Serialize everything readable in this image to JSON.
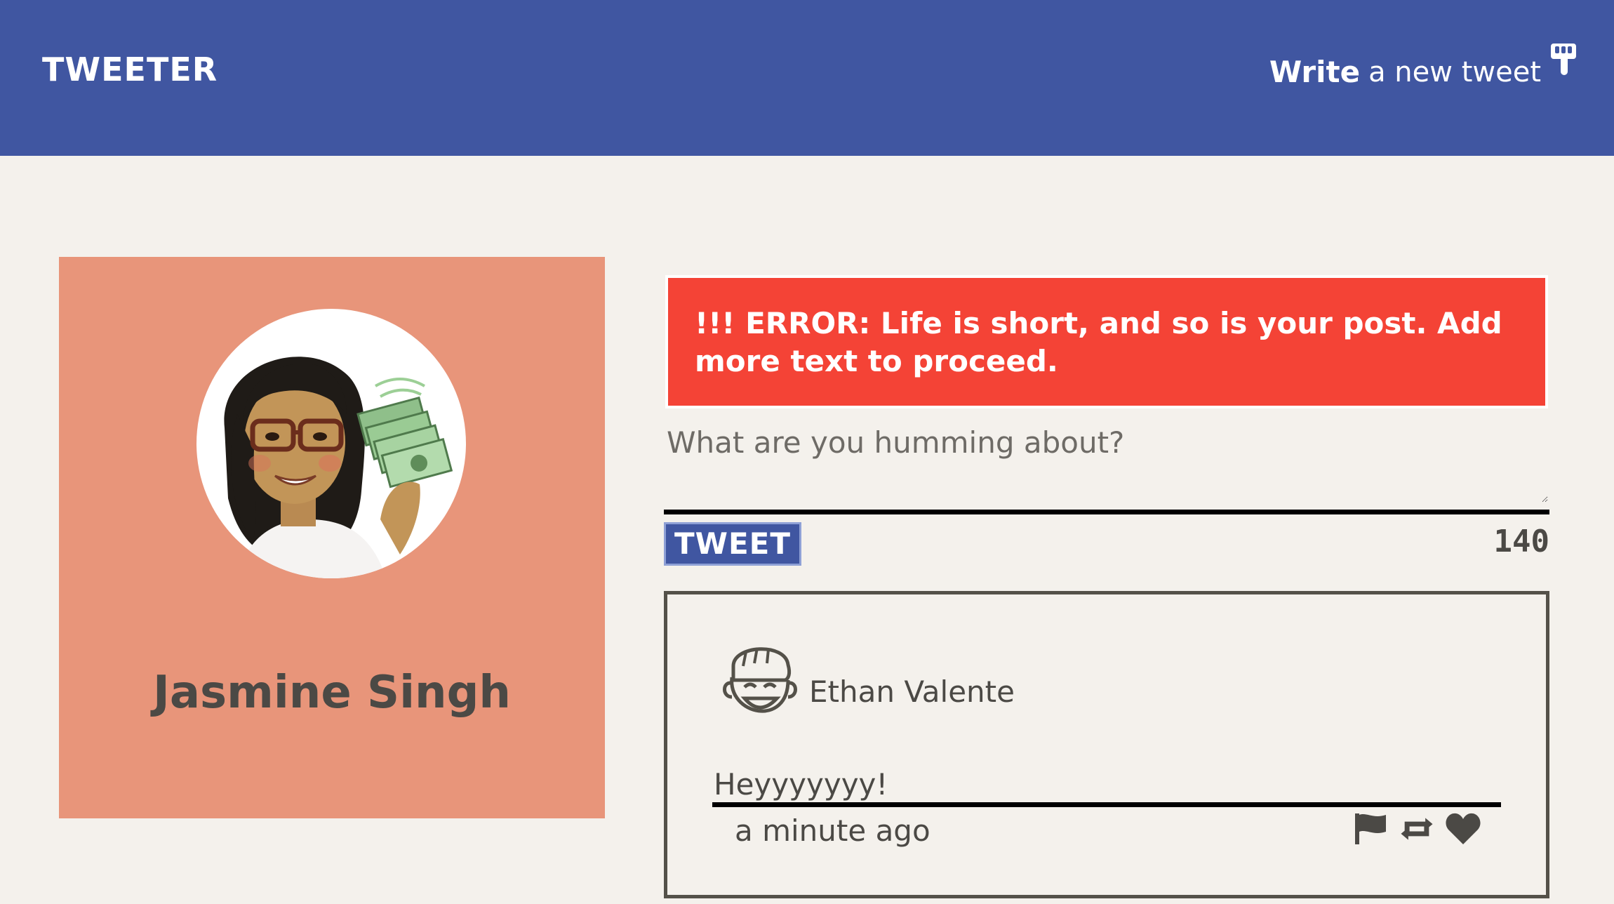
{
  "header": {
    "brand": "TWEETER",
    "compose_write": "Write",
    "compose_rest": "a new tweet",
    "compose_icon": "pointing-hand-down-icon"
  },
  "profile": {
    "name": "Jasmine Singh",
    "avatar": "bitmoji-avatar-with-money",
    "background_color": "#e8957a"
  },
  "composer": {
    "error_message": "!!! ERROR: Life is short, and so is your post. Add more text to proceed.",
    "placeholder": "What are you humming about?",
    "submit_label": "TWEET",
    "char_counter": "140"
  },
  "tweets": [
    {
      "author": "Ethan Valente",
      "avatar_icon": "smiling-face-avatar-icon",
      "body": "Heyyyyyyy!",
      "time": "a minute ago",
      "actions": [
        "flag-icon",
        "retweet-icon",
        "heart-icon"
      ]
    }
  ],
  "colors": {
    "header": "#4056a1",
    "page_bg": "#f4f1ec",
    "error": "#f44336",
    "text": "#4b4945",
    "accent_button": "#4056a1"
  }
}
